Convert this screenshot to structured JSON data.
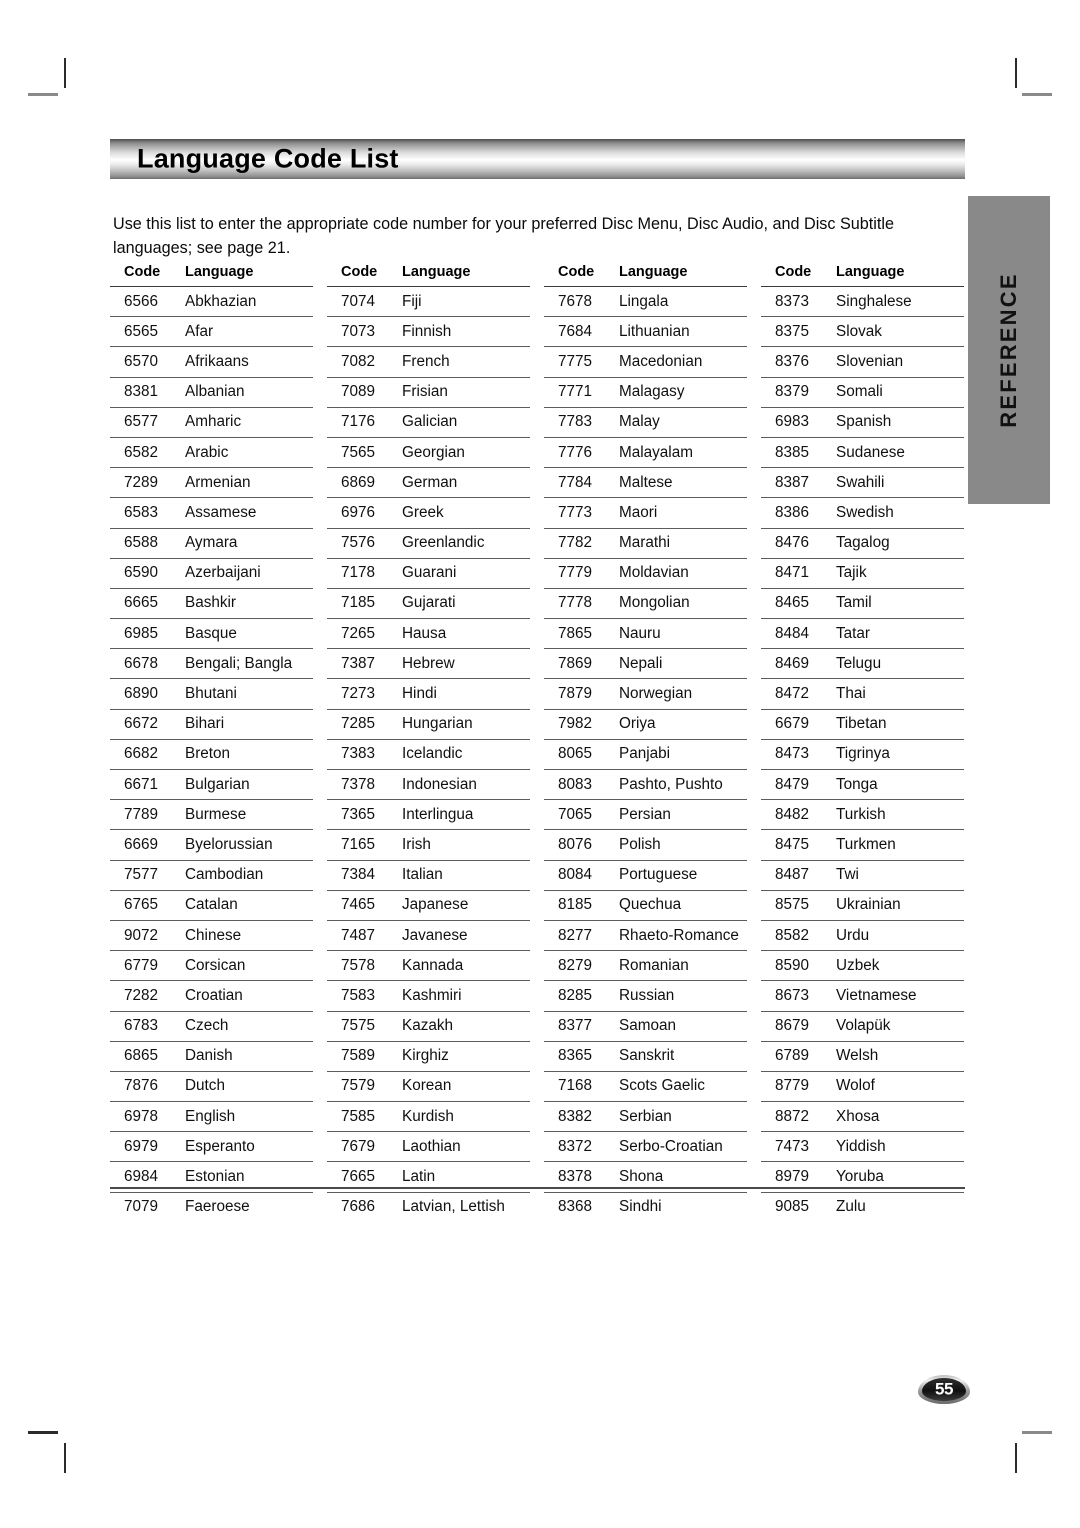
{
  "document": {
    "title": "Language Code List",
    "intro": "Use this list to enter the appropriate code number for your preferred Disc Menu, Disc Audio, and Disc Subtitle languages; see page 21.",
    "page_number": "55",
    "section_tab": "REFERENCE"
  },
  "table": {
    "headers": {
      "code": "Code",
      "language": "Language"
    },
    "columns": [
      {
        "rows": [
          {
            "code": "6566",
            "language": "Abkhazian"
          },
          {
            "code": "6565",
            "language": "Afar"
          },
          {
            "code": "6570",
            "language": "Afrikaans"
          },
          {
            "code": "8381",
            "language": "Albanian"
          },
          {
            "code": "6577",
            "language": "Amharic"
          },
          {
            "code": "6582",
            "language": "Arabic"
          },
          {
            "code": "7289",
            "language": "Armenian"
          },
          {
            "code": "6583",
            "language": "Assamese"
          },
          {
            "code": "6588",
            "language": "Aymara"
          },
          {
            "code": "6590",
            "language": "Azerbaijani"
          },
          {
            "code": "6665",
            "language": "Bashkir"
          },
          {
            "code": "6985",
            "language": "Basque"
          },
          {
            "code": "6678",
            "language": "Bengali; Bangla"
          },
          {
            "code": "6890",
            "language": "Bhutani"
          },
          {
            "code": "6672",
            "language": "Bihari"
          },
          {
            "code": "6682",
            "language": "Breton"
          },
          {
            "code": "6671",
            "language": "Bulgarian"
          },
          {
            "code": "7789",
            "language": "Burmese"
          },
          {
            "code": "6669",
            "language": "Byelorussian"
          },
          {
            "code": "7577",
            "language": "Cambodian"
          },
          {
            "code": "6765",
            "language": "Catalan"
          },
          {
            "code": "9072",
            "language": "Chinese"
          },
          {
            "code": "6779",
            "language": "Corsican"
          },
          {
            "code": "7282",
            "language": "Croatian"
          },
          {
            "code": "6783",
            "language": "Czech"
          },
          {
            "code": "6865",
            "language": "Danish"
          },
          {
            "code": "7876",
            "language": "Dutch"
          },
          {
            "code": "6978",
            "language": "English"
          },
          {
            "code": "6979",
            "language": "Esperanto"
          },
          {
            "code": "6984",
            "language": "Estonian"
          },
          {
            "code": "7079",
            "language": "Faeroese"
          }
        ]
      },
      {
        "rows": [
          {
            "code": "7074",
            "language": "Fiji"
          },
          {
            "code": "7073",
            "language": "Finnish"
          },
          {
            "code": "7082",
            "language": "French"
          },
          {
            "code": "7089",
            "language": "Frisian"
          },
          {
            "code": "7176",
            "language": "Galician"
          },
          {
            "code": "7565",
            "language": "Georgian"
          },
          {
            "code": "6869",
            "language": "German"
          },
          {
            "code": "6976",
            "language": "Greek"
          },
          {
            "code": "7576",
            "language": "Greenlandic"
          },
          {
            "code": "7178",
            "language": "Guarani"
          },
          {
            "code": "7185",
            "language": "Gujarati"
          },
          {
            "code": "7265",
            "language": "Hausa"
          },
          {
            "code": "7387",
            "language": "Hebrew"
          },
          {
            "code": "7273",
            "language": "Hindi"
          },
          {
            "code": "7285",
            "language": "Hungarian"
          },
          {
            "code": "7383",
            "language": "Icelandic"
          },
          {
            "code": "7378",
            "language": "Indonesian"
          },
          {
            "code": "7365",
            "language": "Interlingua"
          },
          {
            "code": "7165",
            "language": "Irish"
          },
          {
            "code": "7384",
            "language": "Italian"
          },
          {
            "code": "7465",
            "language": "Japanese"
          },
          {
            "code": "7487",
            "language": "Javanese"
          },
          {
            "code": "7578",
            "language": "Kannada"
          },
          {
            "code": "7583",
            "language": "Kashmiri"
          },
          {
            "code": "7575",
            "language": "Kazakh"
          },
          {
            "code": "7589",
            "language": "Kirghiz"
          },
          {
            "code": "7579",
            "language": "Korean"
          },
          {
            "code": "7585",
            "language": "Kurdish"
          },
          {
            "code": "7679",
            "language": "Laothian"
          },
          {
            "code": "7665",
            "language": "Latin"
          },
          {
            "code": "7686",
            "language": "Latvian, Lettish"
          }
        ]
      },
      {
        "rows": [
          {
            "code": "7678",
            "language": "Lingala"
          },
          {
            "code": "7684",
            "language": "Lithuanian"
          },
          {
            "code": "7775",
            "language": "Macedonian"
          },
          {
            "code": "7771",
            "language": "Malagasy"
          },
          {
            "code": "7783",
            "language": "Malay"
          },
          {
            "code": "7776",
            "language": "Malayalam"
          },
          {
            "code": "7784",
            "language": "Maltese"
          },
          {
            "code": "7773",
            "language": "Maori"
          },
          {
            "code": "7782",
            "language": "Marathi"
          },
          {
            "code": "7779",
            "language": "Moldavian"
          },
          {
            "code": "7778",
            "language": "Mongolian"
          },
          {
            "code": "7865",
            "language": "Nauru"
          },
          {
            "code": "7869",
            "language": "Nepali"
          },
          {
            "code": "7879",
            "language": "Norwegian"
          },
          {
            "code": "7982",
            "language": "Oriya"
          },
          {
            "code": "8065",
            "language": "Panjabi"
          },
          {
            "code": "8083",
            "language": "Pashto, Pushto"
          },
          {
            "code": "7065",
            "language": "Persian"
          },
          {
            "code": "8076",
            "language": "Polish"
          },
          {
            "code": "8084",
            "language": "Portuguese"
          },
          {
            "code": "8185",
            "language": "Quechua"
          },
          {
            "code": "8277",
            "language": "Rhaeto-Romance"
          },
          {
            "code": "8279",
            "language": "Romanian"
          },
          {
            "code": "8285",
            "language": "Russian"
          },
          {
            "code": "8377",
            "language": "Samoan"
          },
          {
            "code": "8365",
            "language": "Sanskrit"
          },
          {
            "code": "7168",
            "language": "Scots Gaelic"
          },
          {
            "code": "8382",
            "language": "Serbian"
          },
          {
            "code": "8372",
            "language": "Serbo-Croatian"
          },
          {
            "code": "8378",
            "language": "Shona"
          },
          {
            "code": "8368",
            "language": "Sindhi"
          }
        ]
      },
      {
        "rows": [
          {
            "code": "8373",
            "language": "Singhalese"
          },
          {
            "code": "8375",
            "language": "Slovak"
          },
          {
            "code": "8376",
            "language": "Slovenian"
          },
          {
            "code": "8379",
            "language": "Somali"
          },
          {
            "code": "6983",
            "language": "Spanish"
          },
          {
            "code": "8385",
            "language": "Sudanese"
          },
          {
            "code": "8387",
            "language": "Swahili"
          },
          {
            "code": "8386",
            "language": "Swedish"
          },
          {
            "code": "8476",
            "language": "Tagalog"
          },
          {
            "code": "8471",
            "language": "Tajik"
          },
          {
            "code": "8465",
            "language": "Tamil"
          },
          {
            "code": "8484",
            "language": "Tatar"
          },
          {
            "code": "8469",
            "language": "Telugu"
          },
          {
            "code": "8472",
            "language": "Thai"
          },
          {
            "code": "6679",
            "language": "Tibetan"
          },
          {
            "code": "8473",
            "language": "Tigrinya"
          },
          {
            "code": "8479",
            "language": "Tonga"
          },
          {
            "code": "8482",
            "language": "Turkish"
          },
          {
            "code": "8475",
            "language": "Turkmen"
          },
          {
            "code": "8487",
            "language": "Twi"
          },
          {
            "code": "8575",
            "language": "Ukrainian"
          },
          {
            "code": "8582",
            "language": "Urdu"
          },
          {
            "code": "8590",
            "language": "Uzbek"
          },
          {
            "code": "8673",
            "language": "Vietnamese"
          },
          {
            "code": "8679",
            "language": "Volapük"
          },
          {
            "code": "6789",
            "language": "Welsh"
          },
          {
            "code": "8779",
            "language": "Wolof"
          },
          {
            "code": "8872",
            "language": "Xhosa"
          },
          {
            "code": "7473",
            "language": "Yiddish"
          },
          {
            "code": "8979",
            "language": "Yoruba"
          },
          {
            "code": "9085",
            "language": "Zulu"
          }
        ]
      }
    ]
  },
  "colors": {
    "tab_background": "#898989",
    "rule": "#5c5c5c",
    "text": "#101010"
  }
}
